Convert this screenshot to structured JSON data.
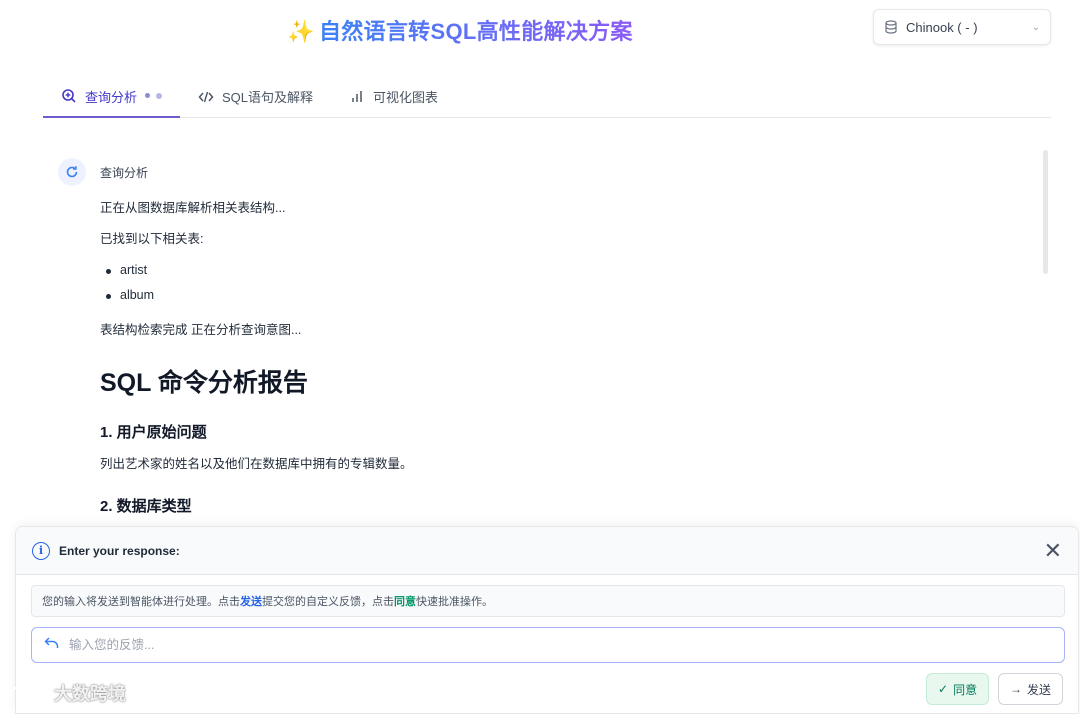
{
  "header": {
    "sparkle": "✨",
    "title": "自然语言转SQL高性能解决方案"
  },
  "db_selector": {
    "value": "Chinook ( - )"
  },
  "tabs": [
    {
      "label": "查询分析",
      "icon": "zoom-plus-icon",
      "active": true
    },
    {
      "label": "SQL语句及解释",
      "icon": "code-icon",
      "active": false
    },
    {
      "label": "可视化图表",
      "icon": "bar-chart-icon",
      "active": false
    }
  ],
  "step": {
    "title": "查询分析",
    "lines": [
      "正在从图数据库解析相关表结构...",
      "已找到以下相关表:"
    ],
    "tables": [
      "artist",
      "album"
    ],
    "status": "表结构检索完成 正在分析查询意图...",
    "report_title": "SQL 命令分析报告",
    "section1_title": "1. 用户原始问题",
    "section1_text": "列出艺术家的姓名以及他们在数据库中拥有的专辑数量。",
    "section2_title": "2. 数据库类型"
  },
  "modal": {
    "title": "Enter your response:",
    "close": "✕",
    "notice_pre": "您的输入将发送到智能体进行处理。点击",
    "notice_send": "发送",
    "notice_mid": "提交您的自定义反馈，点击",
    "notice_agree": "同意",
    "notice_post": "快速批准操作。",
    "input_placeholder": "输入您的反馈...",
    "agree_label": "同意",
    "send_label": "发送"
  },
  "watermark": {
    "text": "大数跨境"
  }
}
